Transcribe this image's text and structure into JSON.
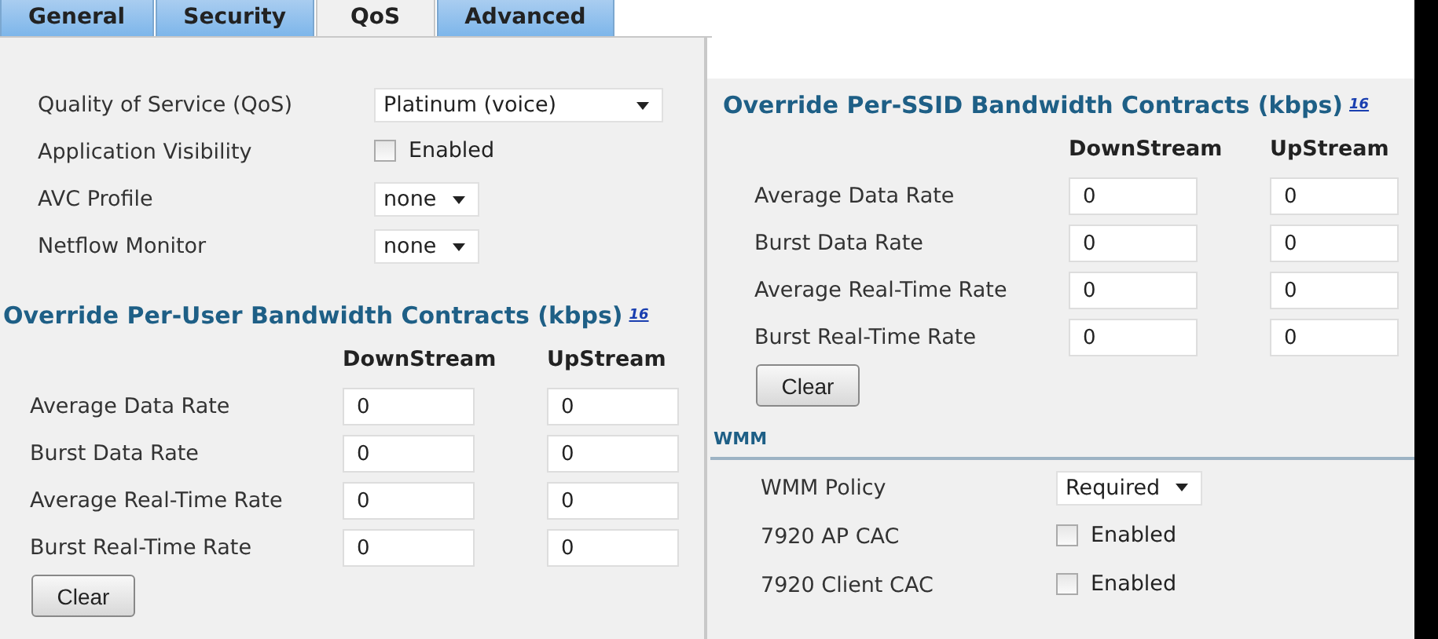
{
  "tabs": [
    {
      "label": "General",
      "selected": false
    },
    {
      "label": "Security",
      "selected": false
    },
    {
      "label": "QoS",
      "selected": true
    },
    {
      "label": "Advanced",
      "selected": false
    }
  ],
  "qos_settings": [
    {
      "kind": "select",
      "label": "Quality of Service (QoS)",
      "value": "Platinum (voice)",
      "wide": true
    },
    {
      "kind": "checkbox",
      "label": "Application Visibility",
      "checked": false,
      "text": "Enabled"
    },
    {
      "kind": "select",
      "label": "AVC Profile",
      "value": "none",
      "wide": false
    },
    {
      "kind": "select",
      "label": "Netflow Monitor",
      "value": "none",
      "wide": false
    }
  ],
  "per_user": {
    "title": "Override Per-User Bandwidth Contracts (kbps)",
    "footnote": "16",
    "columns": [
      "DownStream",
      "UpStream"
    ],
    "rows": [
      {
        "label": "Average Data Rate",
        "values": [
          "0",
          "0"
        ]
      },
      {
        "label": "Burst Data Rate",
        "values": [
          "0",
          "0"
        ]
      },
      {
        "label": "Average Real-Time Rate",
        "values": [
          "0",
          "0"
        ]
      },
      {
        "label": "Burst Real-Time Rate",
        "values": [
          "0",
          "0"
        ]
      }
    ],
    "button": "Clear"
  },
  "per_ssid": {
    "title": "Override Per-SSID Bandwidth Contracts (kbps)",
    "footnote": "16",
    "columns": [
      "DownStream",
      "UpStream"
    ],
    "rows": [
      {
        "label": "Average Data Rate",
        "values": [
          "0",
          "0"
        ]
      },
      {
        "label": "Burst Data Rate",
        "values": [
          "0",
          "0"
        ]
      },
      {
        "label": "Average Real-Time Rate",
        "values": [
          "0",
          "0"
        ]
      },
      {
        "label": "Burst Real-Time Rate",
        "values": [
          "0",
          "0"
        ]
      }
    ],
    "button": "Clear"
  },
  "wmm": {
    "title": "WMM",
    "settings": [
      {
        "kind": "select",
        "label": "WMM Policy",
        "value": "Required",
        "wide": false
      },
      {
        "kind": "checkbox",
        "label": "7920 AP CAC",
        "checked": false,
        "text": "Enabled"
      },
      {
        "kind": "checkbox",
        "label": "7920 Client CAC",
        "checked": false,
        "text": "Enabled"
      }
    ]
  }
}
